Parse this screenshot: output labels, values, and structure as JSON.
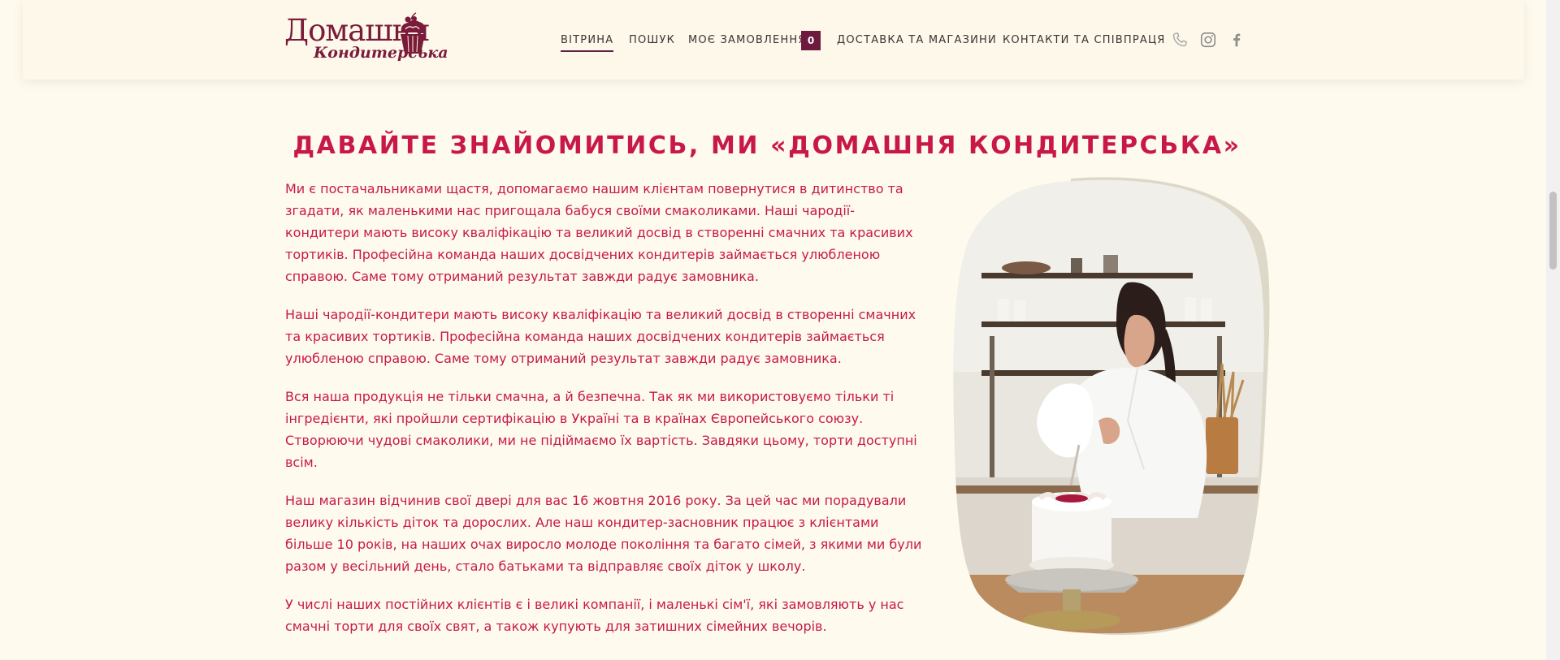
{
  "logo": {
    "line1": "Домашня",
    "line2": "Кондитерська"
  },
  "nav": {
    "items": [
      {
        "label": "ВІТРИНА",
        "active": true
      },
      {
        "label": "ПОШУК"
      },
      {
        "label": "МОЄ ЗАМОВЛЕННЯ"
      },
      {
        "label": "ДОСТАВКА ТА МАГАЗИНИ"
      },
      {
        "label": "КОНТАКТИ ТА СПІВПРАЦЯ"
      }
    ],
    "cart_count": "0",
    "icons": [
      "phone-icon",
      "instagram-icon",
      "facebook-icon"
    ]
  },
  "page": {
    "title": "ДАВАЙТЕ ЗНАЙОМИТИСЬ, МИ «ДОМАШНЯ КОНДИТЕРСЬКА»",
    "paragraphs": [
      "Ми є постачальниками щастя, допомагаємо нашим клієнтам повернутися в дитинство та згадати, як маленькими нас пригощала бабуся своїми смаколиками. Наші чародії-кондитери мають високу кваліфікацію та великий досвід в створенні смачних та красивих тортиків. Професійна команда наших досвідчених кондитерів займається улюбленою справою. Саме тому отриманий результат завжди радує замовника.",
      "Наші чародії-кондитери мають високу кваліфікацію та великий досвід в створенні смачних та красивих тортиків. Професійна команда наших досвідчених кондитерів займається улюбленою справою. Саме тому отриманий результат завжди радує замовника.",
      "Вся наша продукція не тільки смачна, а й безпечна. Так як ми використовуємо тільки ті інгредієнти, які пройшли сертифікацію в Україні та в країнах Європейського союзу. Створюючи чудові смаколики, ми не підіймаємо їх вартість. Завдяки цьому, торти доступні всім.",
      "Наш магазин відчинив свої двері для вас 16 жовтня 2016 року. За цей час ми порадували велику кількість діток та дорослих. Але наш кондитер-засновник працює з клієнтами більше 10 років, на наших очах виросло молоде покоління та багато сімей, з якими ми були разом у весільний день, стало батьками та відправляє своїх діток у школу.",
      "У числі наших постійних клієнтів є і великі компанії, і маленькі сім'ї, які замовляють у нас смачні торти для своїх свят, а також купують для затишних сімейних вечорів."
    ]
  },
  "colors": {
    "accent": "#c8184a",
    "brand": "#7a1b3a",
    "background": "#fefaee"
  }
}
